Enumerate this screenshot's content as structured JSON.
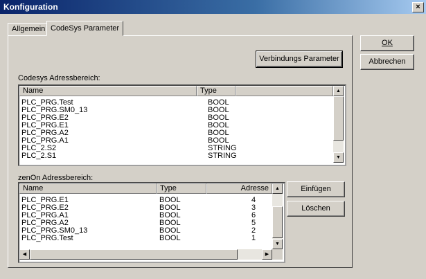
{
  "window": {
    "title": "Konfiguration",
    "close_glyph": "×"
  },
  "tabs": [
    {
      "label": "Allgemein"
    },
    {
      "label": "CodeSys Parameter"
    }
  ],
  "buttons": {
    "ok": {
      "label": "OK"
    },
    "cancel": {
      "label": "Abbrechen"
    },
    "connection": {
      "label": "Verbindungs Parameter"
    },
    "insert": {
      "label": "Einfügen"
    },
    "delete": {
      "label": "Löschen"
    }
  },
  "codesys": {
    "label": "Codesys Adressbereich:",
    "headers": {
      "name": "Name",
      "type": "Type"
    },
    "rows": [
      {
        "name": "PLC_PRG.Test",
        "type": "BOOL"
      },
      {
        "name": "PLC_PRG.SM0_13",
        "type": "BOOL"
      },
      {
        "name": "PLC_PRG.E2",
        "type": "BOOL"
      },
      {
        "name": "PLC_PRG.E1",
        "type": "BOOL"
      },
      {
        "name": "PLC_PRG.A2",
        "type": "BOOL"
      },
      {
        "name": "PLC_PRG.A1",
        "type": "BOOL"
      },
      {
        "name": "PLC_2.S2",
        "type": "STRING"
      },
      {
        "name": "PLC_2.S1",
        "type": "STRING"
      }
    ]
  },
  "zenon": {
    "label": "zenOn Adressbereich:",
    "headers": {
      "name": "Name",
      "type": "Type",
      "address": "Adresse"
    },
    "rows": [
      {
        "name": "PLC_PRG.E1",
        "type": "BOOL",
        "address": "4"
      },
      {
        "name": "PLC_PRG.E2",
        "type": "BOOL",
        "address": "3"
      },
      {
        "name": "PLC_PRG.A1",
        "type": "BOOL",
        "address": "6"
      },
      {
        "name": "PLC_PRG.A2",
        "type": "BOOL",
        "address": "5"
      },
      {
        "name": "PLC_PRG.SM0_13",
        "type": "BOOL",
        "address": "2"
      },
      {
        "name": "PLC_PRG.Test",
        "type": "BOOL",
        "address": "1"
      }
    ]
  },
  "icons": {
    "scroll_up": "▲",
    "scroll_down": "▼",
    "scroll_left": "◀",
    "scroll_right": "▶"
  }
}
